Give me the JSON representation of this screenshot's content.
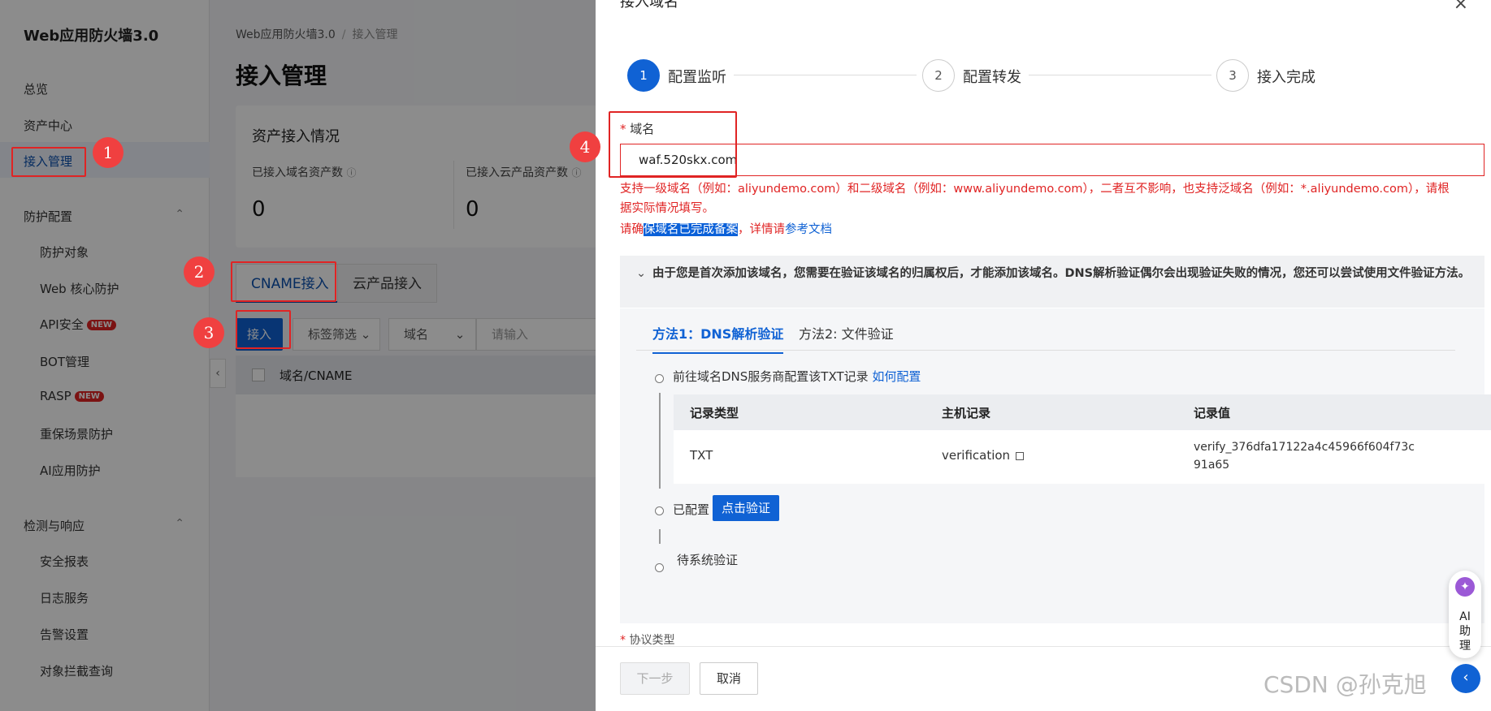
{
  "sidebar": {
    "brand": "Web应用防火墙3.0",
    "items": [
      {
        "label": "总览"
      },
      {
        "label": "资产中心"
      },
      {
        "label": "接入管理"
      },
      {
        "label": "防护配置"
      },
      {
        "label": "防护对象"
      },
      {
        "label": "Web 核心防护"
      },
      {
        "label": "API安全"
      },
      {
        "label": "BOT管理"
      },
      {
        "label": "RASP"
      },
      {
        "label": "重保场景防护"
      },
      {
        "label": "AI应用防护"
      },
      {
        "label": "检测与响应"
      },
      {
        "label": "安全报表"
      },
      {
        "label": "日志服务"
      },
      {
        "label": "告警设置"
      },
      {
        "label": "对象拦截查询"
      }
    ],
    "badge_new": "NEW",
    "chevron_up": "⌃"
  },
  "annotations": {
    "n1": "1",
    "n2": "2",
    "n3": "3",
    "n4": "4"
  },
  "main": {
    "breadcrumb": {
      "root": "Web应用防火墙3.0",
      "sep": "/",
      "current": "接入管理"
    },
    "title": "接入管理",
    "card_title": "资产接入情况",
    "stat1_label": "已接入域名资产数",
    "stat1_value": "0",
    "stat2_label": "已接入云产品资产数",
    "stat2_value": "0",
    "tab_cname": "CNAME接入",
    "tab_cloud": "云产品接入",
    "btn_access": "接入",
    "filter_tag": "标签筛选",
    "filter_domain": "域名",
    "search_placeholder": "请输入",
    "col_domain": "域名/CNAME"
  },
  "drawer": {
    "title": "接入域名",
    "steps": [
      {
        "num": "1",
        "label": "配置监听"
      },
      {
        "num": "2",
        "label": "配置转发"
      },
      {
        "num": "3",
        "label": "接入完成"
      }
    ],
    "required_mark": "*",
    "domain_label": "域名",
    "domain_value": "waf.520skx.com",
    "hint_line1": "支持一级域名（例如：aliyundemo.com）和二级域名（例如：www.aliyundemo.com），二者互不影响，也支持泛域名（例如：*.aliyundemo.com），请根",
    "hint_line2": "据实际情况填写。",
    "hint3_pre": "请确",
    "hint3_hl": "保域名已完成备案",
    "hint3_mid": "，详情请",
    "hint3_link": "参考文档",
    "notice": "由于您是首次添加该域名，您需要在验证该域名的归属权后，才能添加该域名。DNS解析验证偶尔会出现验证失败的情况，您还可以尝试使用文件验证方法。",
    "method1": "方法1：DNS解析验证",
    "method2": "方法2: 文件验证",
    "step_a": "前往域名DNS服务商配置该TXT记录",
    "step_a_link": "如何配置",
    "record_headers": [
      "记录类型",
      "主机记录",
      "记录值"
    ],
    "record_type": "TXT",
    "record_host": "verification",
    "record_value_l1": "verify_376dfa17122a4c45966f604f73c",
    "record_value_l2": "91a65",
    "step_b": "已配置",
    "step_b_btn": "点击验证",
    "step_c": "待系统验证",
    "protocol_label": "协议类型",
    "btn_next": "下一步",
    "btn_cancel": "取消"
  },
  "ai_assistant": "AI助理",
  "watermark": "CSDN @孙克旭"
}
